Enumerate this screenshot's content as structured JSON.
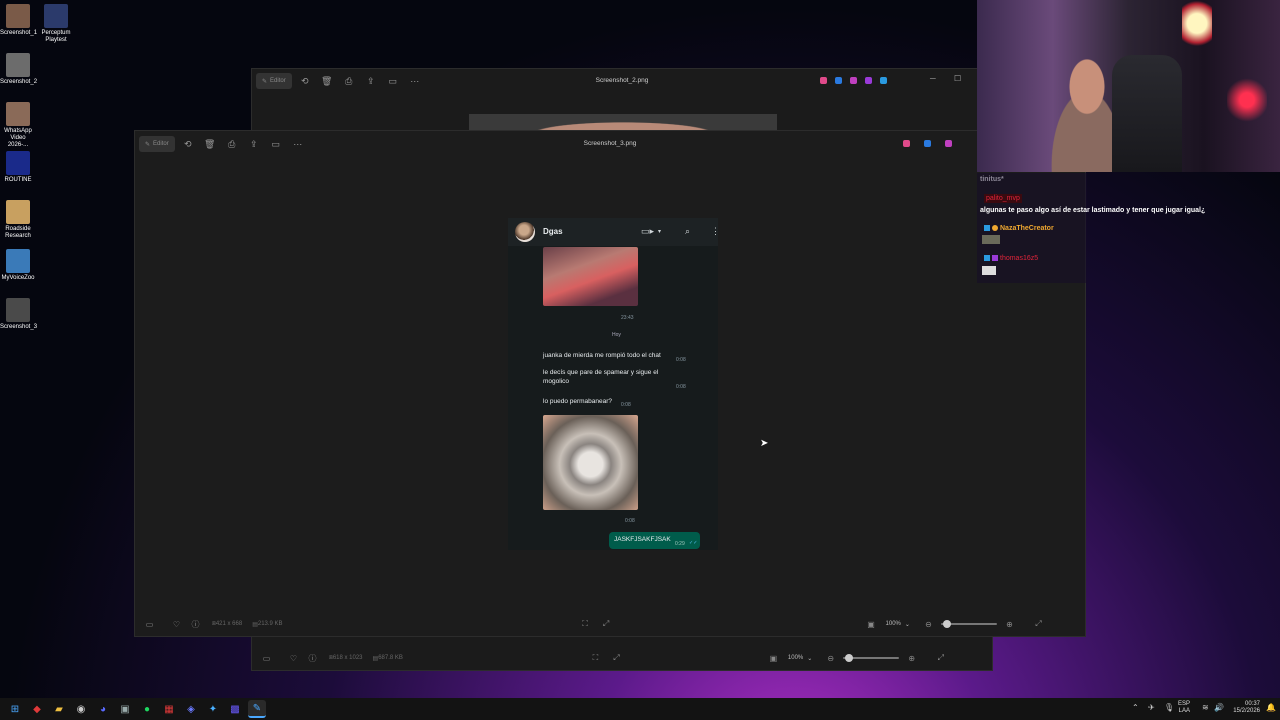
{
  "desktop": {
    "icons": [
      {
        "label": "Screenshot_1",
        "color": "#7a5a48"
      },
      {
        "label": "Perceptum Playtest",
        "color": "#2b3a6b"
      },
      {
        "label": "Screenshot_2",
        "color": "#6c6c6c"
      },
      {
        "label": "WhatsApp Video 2026-...",
        "color": "#8a6a58"
      },
      {
        "label": "ROUTINE",
        "color": "#1a2a8a"
      },
      {
        "label": "Roadside Research",
        "color": "#c8a060"
      },
      {
        "label": "MyVoiceZoo",
        "color": "#3a7ab8"
      },
      {
        "label": "Screenshot_3",
        "color": "#4a4a4a"
      }
    ]
  },
  "back_window": {
    "title": "Screenshot_2.png",
    "editor_label": "Editor",
    "dimensions": "618 x 1023",
    "size": "687.8 KB",
    "zoom": "100%",
    "zoom_fraction": 0.1
  },
  "front_window": {
    "title": "Screenshot_3.png",
    "editor_label": "Editor",
    "dimensions": "421 x 668",
    "size": "213.9 KB",
    "zoom": "100%",
    "zoom_fraction": 0.1
  },
  "chat": {
    "contact": "Dgas",
    "messages": [
      {
        "time": "23:43"
      },
      {
        "day_divider": "Hoy"
      },
      {
        "text": "juanka de mierda me rompió todo el chat",
        "time": "0:08"
      },
      {
        "text": "le decís que pare de spamear y sigue el mogolico",
        "time": "0:08"
      },
      {
        "text": "lo puedo permabanear?",
        "time": "0:08"
      },
      {
        "time": "0:08"
      },
      {
        "text": "JASKFJSAKFJSAK",
        "time": "0:29"
      }
    ]
  },
  "stream": {
    "title": "tinitus*",
    "chat": [
      {
        "user": "palito_mvp",
        "color": "#e0243a",
        "text": "algunas te paso algo así de estar lastimado y tener que jugar igual¿"
      },
      {
        "user": "NazaTheCreator",
        "color": "#f0a830"
      },
      {
        "user": "thomas16z5",
        "color": "#e0243a"
      }
    ]
  },
  "taskbar": {
    "lang_1": "ESP",
    "lang_2": "LAA",
    "time": "00:37",
    "date": "15/2/2026"
  },
  "colors": {
    "accent_purple": "#b02fc6",
    "wa_sent": "#005c4b"
  }
}
